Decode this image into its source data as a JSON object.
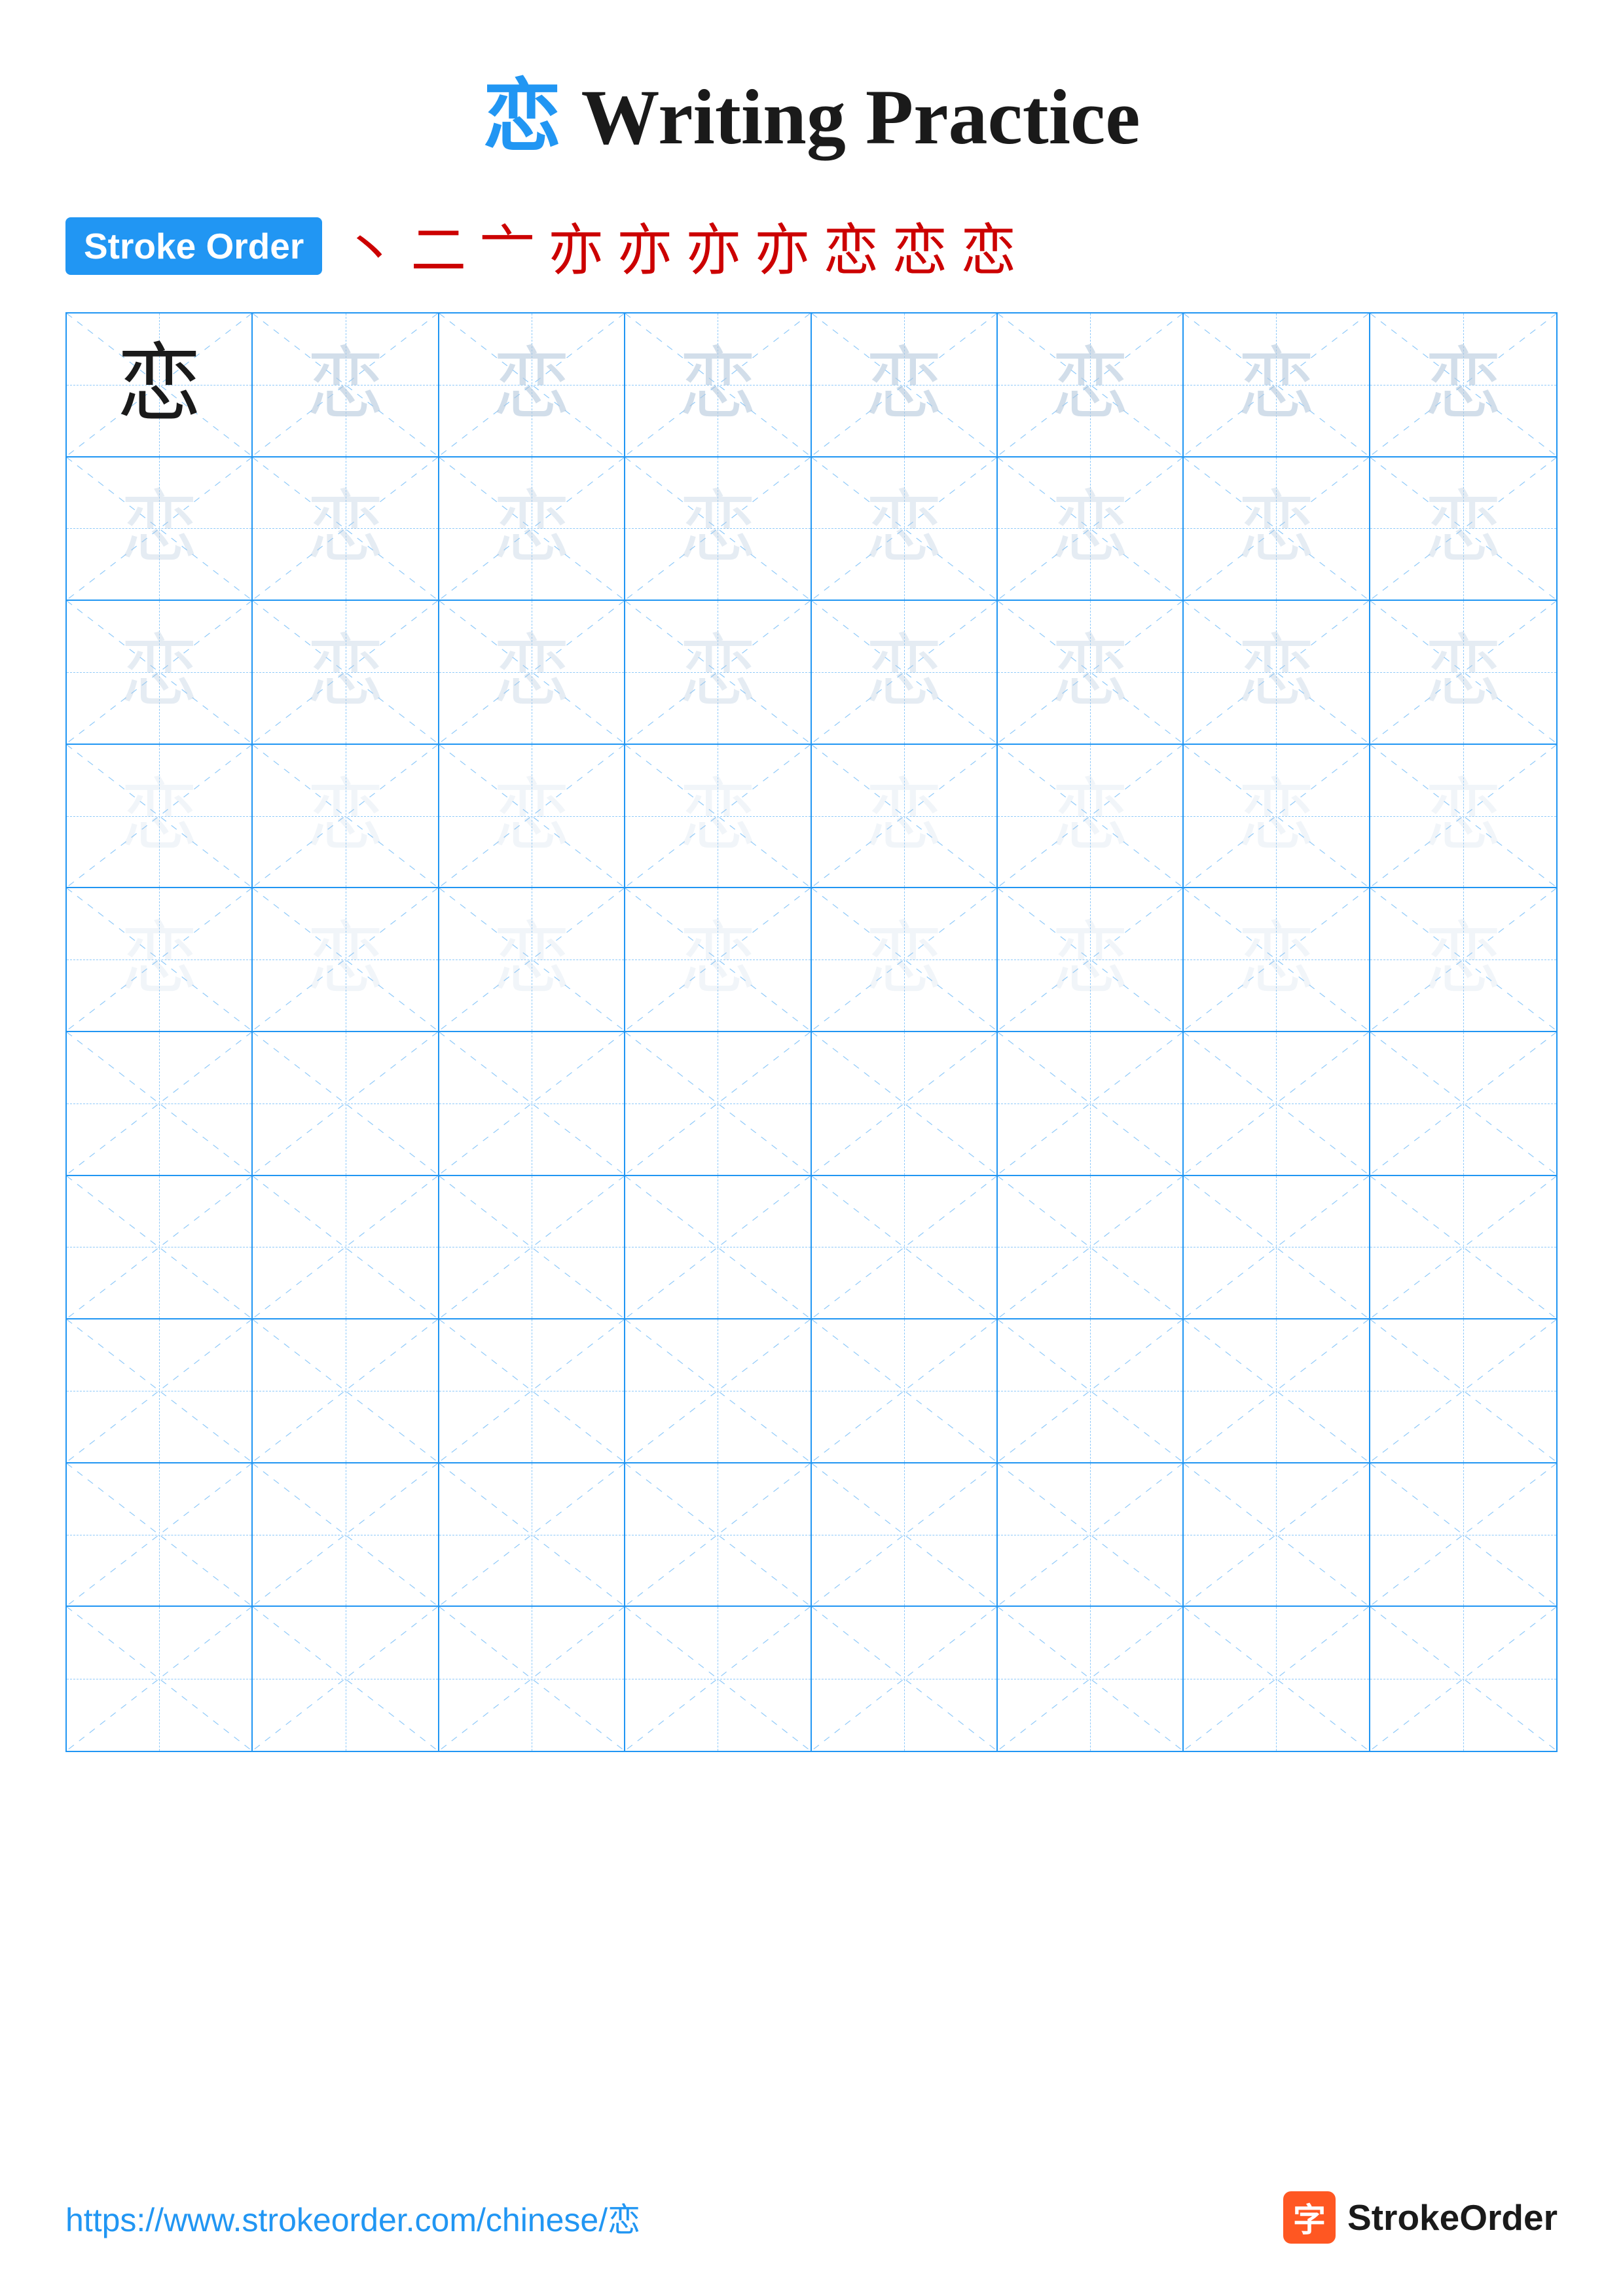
{
  "page": {
    "title": "Writing Practice",
    "kanji": "恋",
    "title_full": "恋 Writing Practice"
  },
  "stroke_order": {
    "badge_label": "Stroke Order",
    "strokes": [
      "丶",
      "二",
      "亠",
      "亦",
      "亦",
      "亦",
      "亦",
      "恋",
      "恋",
      "恋"
    ]
  },
  "grid": {
    "rows": 10,
    "cols": 8
  },
  "footer": {
    "url": "https://www.strokeorder.com/chinese/恋",
    "brand_name": "StrokeOrder",
    "brand_char": "字"
  }
}
